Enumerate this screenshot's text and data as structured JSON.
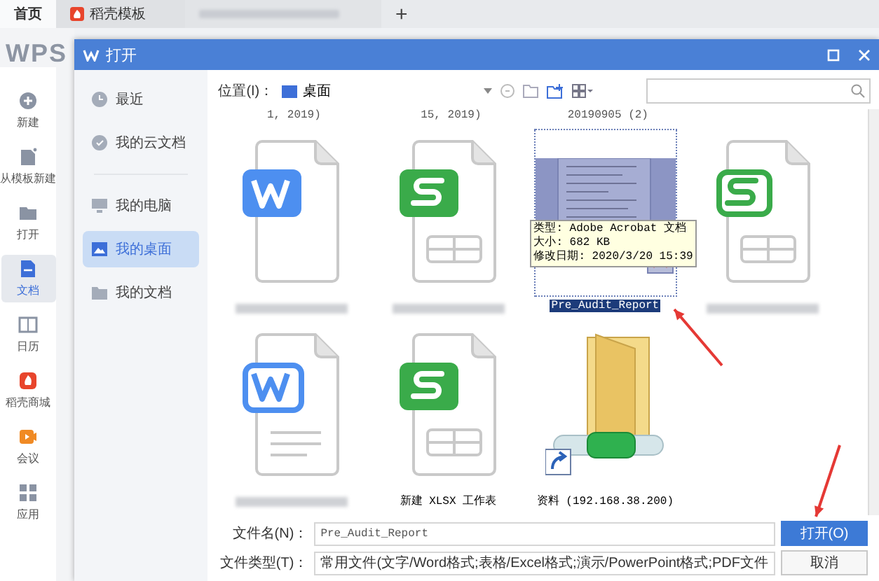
{
  "tabs": [
    {
      "kind": "home",
      "label": "首页",
      "selected": true
    },
    {
      "kind": "docer",
      "label": "稻壳模板",
      "selected": false
    },
    {
      "kind": "blurred",
      "selected": false
    }
  ],
  "new_tab": "+",
  "app": {
    "logo": "WPS",
    "sidebar": [
      {
        "label": "新建",
        "selected": false
      },
      {
        "label": "从模板新建",
        "selected": false
      },
      {
        "label": "打开",
        "selected": false
      },
      {
        "label": "文档",
        "selected": true
      },
      {
        "label": "日历",
        "selected": false
      },
      {
        "label": "稻壳商城",
        "selected": false
      },
      {
        "label": "会议",
        "selected": false
      },
      {
        "label": "应用",
        "selected": false
      }
    ]
  },
  "dialog": {
    "title": "打开",
    "nav": [
      {
        "label": "最近",
        "selected": false
      },
      {
        "label": "我的云文档",
        "selected": false
      },
      {
        "label": "我的电脑",
        "selected": false
      },
      {
        "label": "我的桌面",
        "selected": true
      },
      {
        "label": "我的文档",
        "selected": false
      }
    ],
    "location_label": "位置(I)：",
    "location": "桌面",
    "cut_names": [
      "1, 2019)",
      "15, 2019)",
      "20190905 (2)"
    ],
    "files": [
      {
        "kind": "word",
        "blurred": true,
        "selected": false
      },
      {
        "kind": "sheet",
        "blurred": true,
        "selected": false
      },
      {
        "kind": "pdf",
        "name": "Pre_Audit_Report",
        "selected": true,
        "tooltip": [
          "类型: Adobe Acrobat 文档",
          "大小: 682 KB",
          "修改日期: 2020/3/20 15:39"
        ]
      },
      {
        "kind": "sheet-outline",
        "blurred": true,
        "selected": false
      },
      {
        "kind": "word-outline",
        "blurred": true,
        "selected": false
      },
      {
        "kind": "sheet",
        "name": "新建 XLSX 工作表",
        "selected": false
      },
      {
        "kind": "network-folder",
        "name": "资料 (192.168.38.200)",
        "selected": false
      }
    ],
    "filename_label": "文件名(N)：",
    "filename": "Pre_Audit_Report",
    "filetype_label": "文件类型(T)：",
    "filetype": "常用文件(文字/Word格式;表格/Excel格式;演示/PowerPoint格式;PDF文件",
    "buttons": [
      {
        "kind": "primary",
        "label": "打开(O)"
      },
      {
        "kind": "secondary",
        "label": "取消"
      }
    ]
  }
}
